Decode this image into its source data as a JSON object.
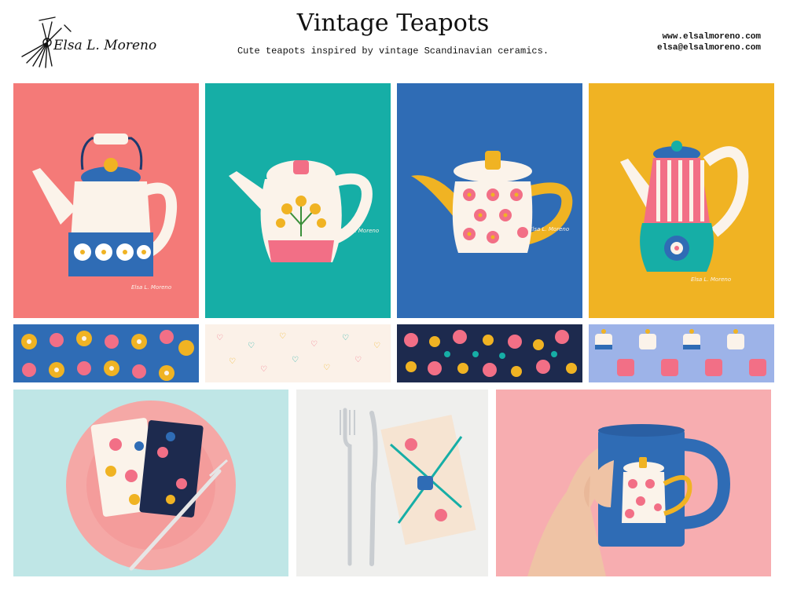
{
  "header": {
    "logo_text": "Elsa L. Moreno",
    "title": "Vintage Teapots",
    "subtitle": "Cute teapots inspired by vintage Scandinavian ceramics.",
    "website": "www.elsalmoreno.com",
    "email": "elsa@elsalmoreno.com"
  },
  "colors": {
    "coral": "#f47a78",
    "teal": "#16aea6",
    "blue": "#2f6cb5",
    "mustard": "#f0b323",
    "navy": "#1d3a6e",
    "cream": "#fbf6ef",
    "pink": "#f26f86",
    "periwinkle": "#9db3e8"
  },
  "artworks": [
    {
      "name": "coral-teapot-card",
      "signature": "Elsa L. Moreno"
    },
    {
      "name": "teal-teapot-card",
      "signature": "Elsa L. Moreno"
    },
    {
      "name": "blue-teapot-card",
      "signature": "Elsa L. Moreno"
    },
    {
      "name": "mustard-teapot-card",
      "signature": "Elsa L. Moreno"
    }
  ],
  "patterns": [
    "floral-blue",
    "hearts-cream",
    "floral-navy",
    "teapots-periwinkle"
  ],
  "mockups": [
    "napkin-plate",
    "cutlery-napkin",
    "mug-in-hand"
  ]
}
